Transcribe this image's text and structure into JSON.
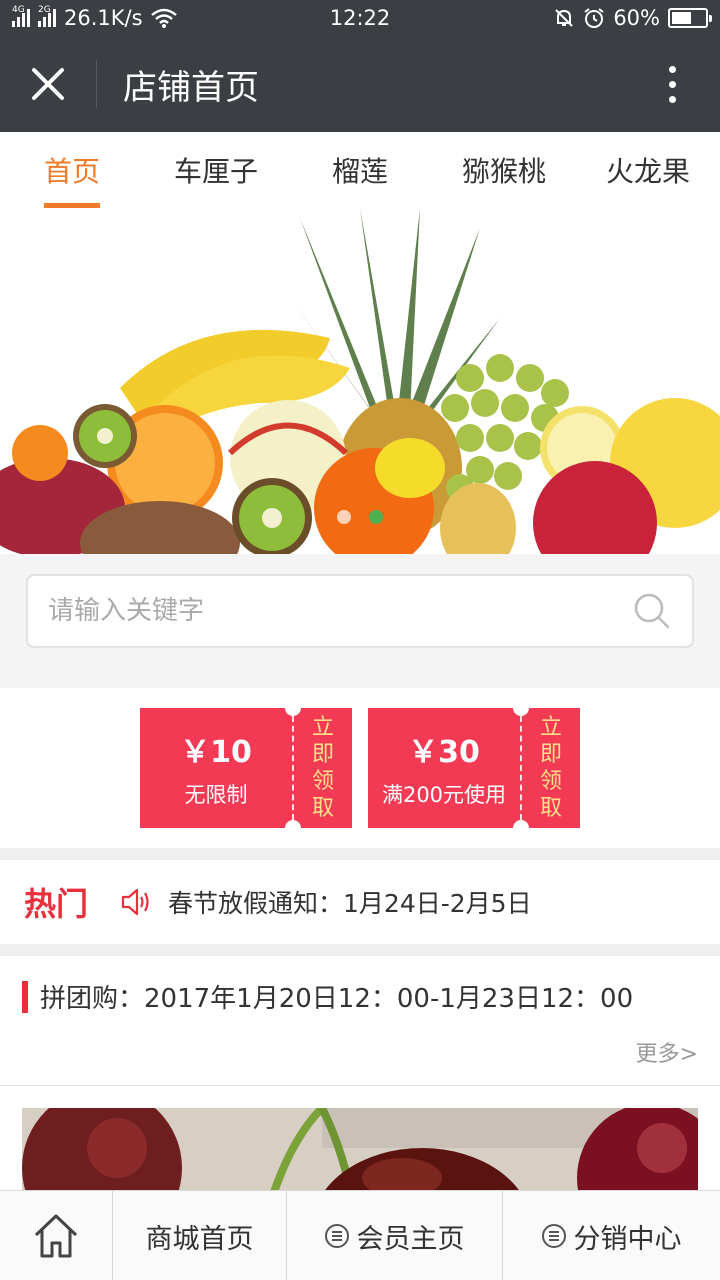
{
  "status_bar": {
    "net_4g": "4G",
    "net_2g": "2G",
    "speed": "26.1K/s",
    "time": "12:22",
    "battery": "60%",
    "battery_level": 0.6
  },
  "title_bar": {
    "title": "店铺首页",
    "close_icon": "close-icon",
    "more_icon": "more-vertical-icon"
  },
  "tabs": [
    {
      "label": "首页",
      "active": true
    },
    {
      "label": "车厘子",
      "active": false
    },
    {
      "label": "榴莲",
      "active": false
    },
    {
      "label": "猕猴桃",
      "active": false
    },
    {
      "label": "火龙果",
      "active": false
    }
  ],
  "banner": {
    "slide_count": 2,
    "active_slide": 2
  },
  "search": {
    "placeholder": "请输入关键字",
    "value": ""
  },
  "coupons": [
    {
      "amount": "￥10",
      "condition": "无限制",
      "claim": [
        "立",
        "即",
        "领",
        "取"
      ]
    },
    {
      "amount": "￥30",
      "condition": "满200元使用",
      "claim": [
        "立",
        "即",
        "领",
        "取"
      ]
    }
  ],
  "hot": {
    "label": "热门",
    "notice": "春节放假通知：1月24日-2月5日"
  },
  "group_buy": {
    "title": "拼团购：2017年1月20日12：00-1月23日12：00",
    "more": "更多>"
  },
  "bottom_nav": {
    "home_icon": "home-icon",
    "items": [
      {
        "label": "商城首页"
      },
      {
        "label": "会员主页",
        "icon": "menu-icon"
      },
      {
        "label": "分销中心",
        "icon": "menu-icon"
      }
    ]
  },
  "colors": {
    "accent": "#f07a28",
    "coupon": "#f23a55",
    "coupon_text": "#ffe08a",
    "hot": "#e8303c",
    "dark_bar": "#3b3e42"
  }
}
